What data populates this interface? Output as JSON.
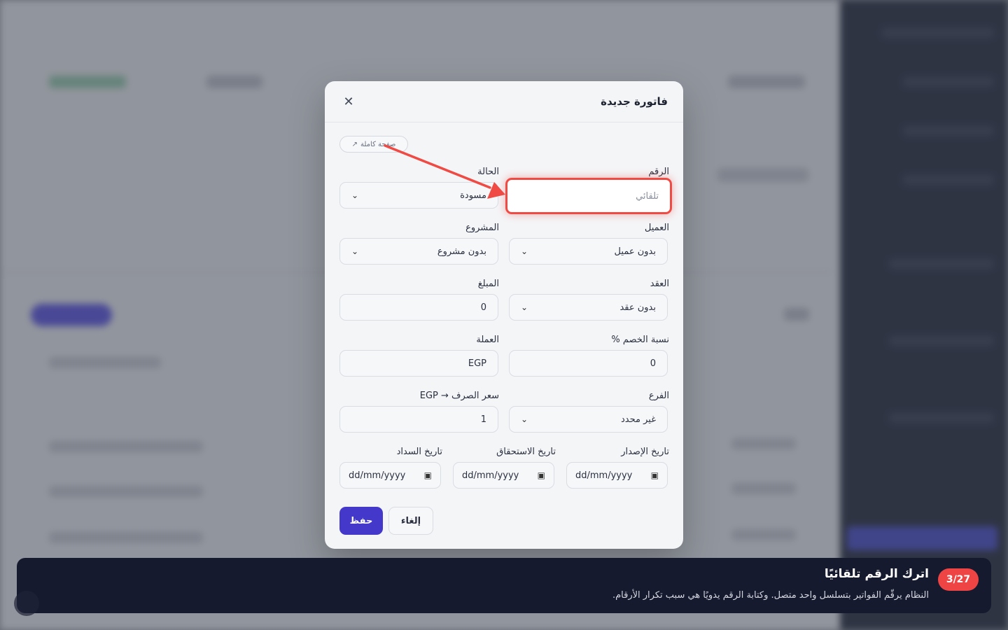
{
  "modal": {
    "title": "فاتورة جديدة",
    "full_page_label": "صفحة كاملة",
    "fields": {
      "number": {
        "label": "الرقم",
        "placeholder": "تلقائي"
      },
      "status": {
        "label": "الحالة",
        "value": "مسودة"
      },
      "client": {
        "label": "العميل",
        "value": "بدون عميل"
      },
      "project": {
        "label": "المشروع",
        "value": "بدون مشروع"
      },
      "contract": {
        "label": "العقد",
        "value": "بدون عقد"
      },
      "amount": {
        "label": "المبلغ",
        "value": "0"
      },
      "discount": {
        "label": "نسبة الخصم %",
        "value": "0"
      },
      "currency": {
        "label": "العملة",
        "value": "EGP"
      },
      "branch": {
        "label": "الفرع",
        "value": "غير محدد"
      },
      "exchange_rate": {
        "label": "سعر الصرف → EGP",
        "value": "1"
      },
      "issue_date": {
        "label": "تاريخ الإصدار",
        "value": "dd/mm/yyyy"
      },
      "due_date": {
        "label": "تاريخ الاستحقاق",
        "value": "dd/mm/yyyy"
      },
      "payment_date": {
        "label": "تاريخ السداد",
        "value": "dd/mm/yyyy"
      }
    },
    "save_label": "حفظ",
    "cancel_label": "إلغاء"
  },
  "tour": {
    "step": "3/27",
    "title": "اترك الرقم تلقائيًا",
    "description": "النظام يرقّم الفواتير بتسلسل واحد متصل. وكتابة الرقم يدويًا هي سبب تكرار الأرقام."
  },
  "colors": {
    "accent": "#4338ca",
    "highlight": "#f04a44",
    "tour_bg": "#161a2e"
  }
}
